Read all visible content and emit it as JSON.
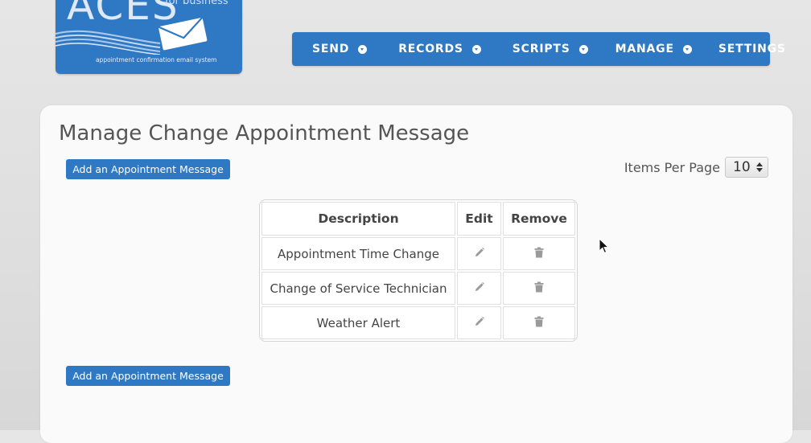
{
  "logo": {
    "word": "ACES",
    "sub": "for business",
    "tagline": "appointment confirmation email system"
  },
  "nav": {
    "items": [
      {
        "label": "SEND",
        "has_dropdown": true
      },
      {
        "label": "RECORDS",
        "has_dropdown": true
      },
      {
        "label": "SCRIPTS",
        "has_dropdown": true
      },
      {
        "label": "MANAGE",
        "has_dropdown": true
      },
      {
        "label": "SETTINGS",
        "has_dropdown": false
      }
    ]
  },
  "page": {
    "title": "Manage Change Appointment Message",
    "add_button_label": "Add an Appointment Message",
    "items_per_page_label": "Items Per Page",
    "items_per_page_value": "10"
  },
  "table": {
    "headers": [
      "Description",
      "Edit",
      "Remove"
    ],
    "rows": [
      {
        "description": "Appointment Time Change",
        "edit_icon": "pencil-icon",
        "remove_icon": "trash-icon"
      },
      {
        "description": "Change of Service Technician",
        "edit_icon": "pencil-icon",
        "remove_icon": "trash-icon"
      },
      {
        "description": "Weather Alert",
        "edit_icon": "pencil-icon",
        "remove_icon": "trash-icon"
      }
    ]
  },
  "colors": {
    "accent": "#2f78c4",
    "background": "#e0e0e0",
    "panel": "#fafafa"
  }
}
